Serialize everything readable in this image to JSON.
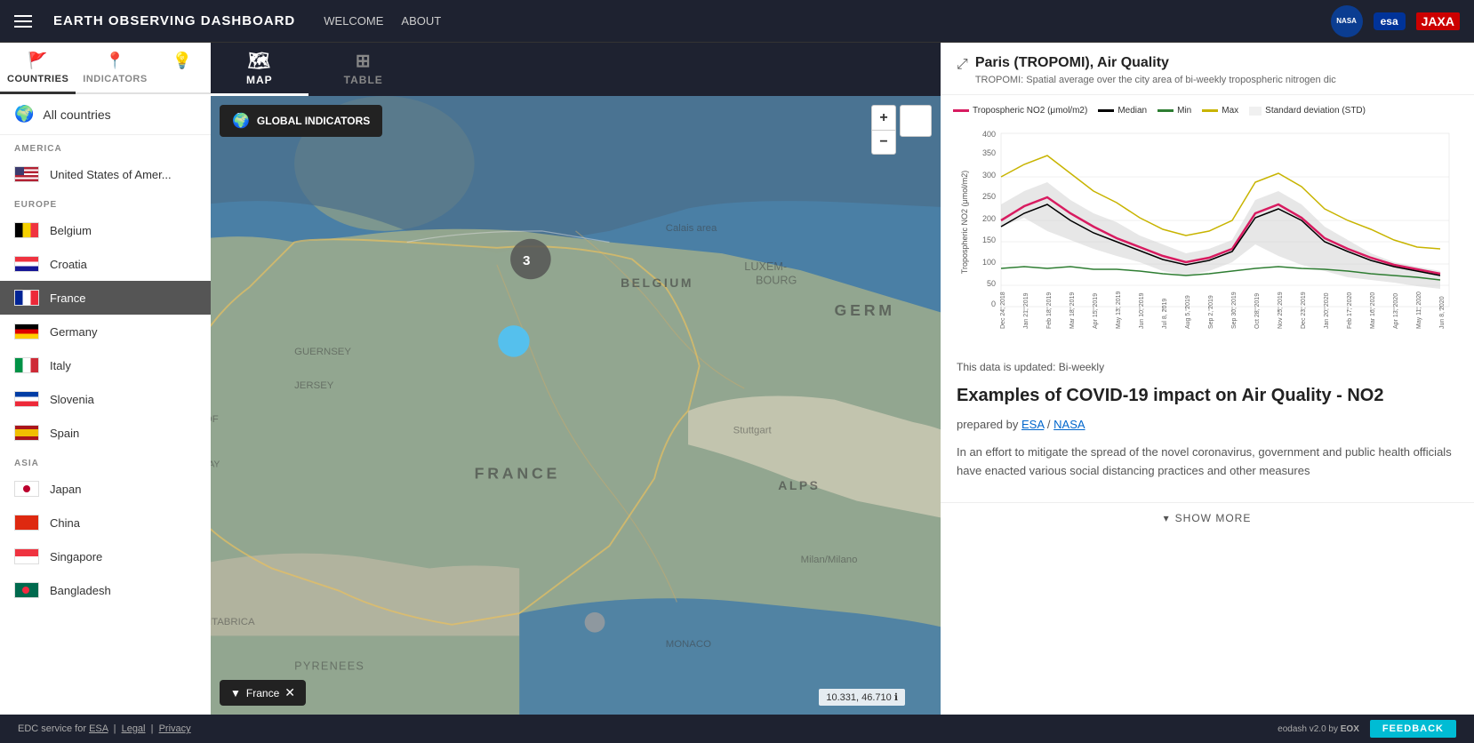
{
  "app": {
    "title": "EARTH OBSERVING DASHBOARD",
    "nav_welcome": "WELCOME",
    "nav_about": "ABOUT"
  },
  "sidebar": {
    "tab_countries": "COUNTRIES",
    "tab_indicators": "INDICATORS",
    "all_countries": "All countries",
    "regions": [
      {
        "name": "AMERICA",
        "countries": [
          {
            "name": "United States of Amer...",
            "code": "us",
            "active": false
          }
        ]
      },
      {
        "name": "EUROPE",
        "countries": [
          {
            "name": "Belgium",
            "code": "belgium",
            "active": false
          },
          {
            "name": "Croatia",
            "code": "croatia",
            "active": false
          },
          {
            "name": "France",
            "code": "france",
            "active": true
          },
          {
            "name": "Germany",
            "code": "germany",
            "active": false
          },
          {
            "name": "Italy",
            "code": "italy",
            "active": false
          },
          {
            "name": "Slovenia",
            "code": "slovenia",
            "active": false
          },
          {
            "name": "Spain",
            "code": "spain",
            "active": false
          }
        ]
      },
      {
        "name": "ASIA",
        "countries": [
          {
            "name": "Japan",
            "code": "japan",
            "active": false
          },
          {
            "name": "China",
            "code": "china",
            "active": false
          },
          {
            "name": "Singapore",
            "code": "singapore",
            "active": false
          },
          {
            "name": "Bangladesh",
            "code": "bangladesh",
            "active": false
          }
        ]
      }
    ]
  },
  "map_tab": {
    "map_label": "MAP",
    "table_label": "TABLE",
    "global_indicators": "GLOBAL INDICATORS",
    "cluster_number": "3",
    "filter_country": "France",
    "coordinates": "10.331, 46.710",
    "attribution": "EDC service for ESA | Legal | Privacy"
  },
  "right_panel": {
    "title": "Paris (TROPOMI), Air Quality",
    "subtitle": "TROPOMI: Spatial average over the city area of bi-weekly tropospheric nitrogen dic",
    "chart": {
      "y_label": "Tropospheric NO2 (μmol/m2)",
      "legend": [
        {
          "label": "Tropospheric NO2 (μmol/m2)",
          "color": "#d81b60",
          "type": "line"
        },
        {
          "label": "Median",
          "color": "#000000",
          "type": "line"
        },
        {
          "label": "Min",
          "color": "#2e7d32",
          "type": "line"
        },
        {
          "label": "Max",
          "color": "#c8b400",
          "type": "line"
        },
        {
          "label": "Standard deviation (STD)",
          "color": "#cccccc",
          "type": "area"
        }
      ],
      "x_labels": [
        "Dec 24, 2018",
        "Jan 21, 2019",
        "Feb 18, 2019",
        "Mar 18, 2019",
        "Apr 15, 2019",
        "May 13, 2019",
        "Jun 10, 2019",
        "Jul 8, 2019",
        "Aug 5, 2019",
        "Sep 2, 2019",
        "Sep 30, 2019",
        "Oct 28, 2019",
        "Nov 25, 2019",
        "Dec 23, 2019",
        "Jan 20, 2020",
        "Feb 17, 2020",
        "Mar 16, 2020",
        "Apr 13, 2020",
        "May 11, 2020",
        "Jun 8, 2020"
      ],
      "y_max": 400,
      "y_ticks": [
        0,
        50,
        100,
        150,
        200,
        250,
        300,
        350,
        400
      ]
    },
    "update_text": "This data is updated: Bi-weekly",
    "section_title": "Examples of COVID-19 impact on Air Quality - NO2",
    "prepared_by": "prepared by",
    "esa_link": "ESA",
    "nasa_link": "NASA",
    "body_text": "In an effort to mitigate the spread of the novel coronavirus, government and public health officials have enacted various social distancing practices and other measures",
    "show_more": "SHOW MORE"
  },
  "bottom_bar": {
    "attribution": "EDC service for ",
    "esa": "ESA",
    "legal": "Legal",
    "privacy": "Privacy",
    "version": "eodash v2.0 by",
    "feedback": "FEEDBACK"
  }
}
